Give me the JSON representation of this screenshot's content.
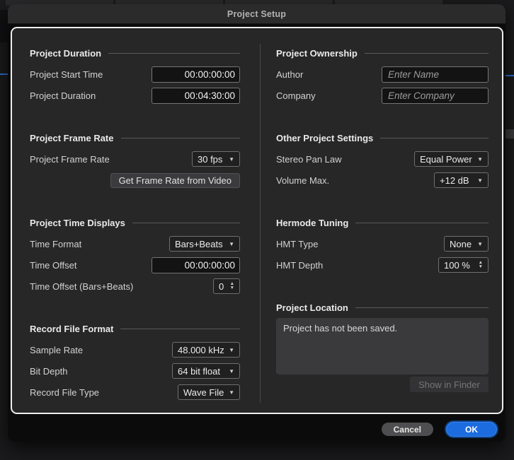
{
  "window": {
    "title": "Project Setup"
  },
  "icons": {
    "dropdown_arrow": "▼",
    "stepper_up": "▲",
    "stepper_down": "▼"
  },
  "colors": {
    "accent_blue": "#1c6cdf",
    "panel_bg": "#272728",
    "dialog_bg": "#0b0b0c",
    "panel_border": "#ededee"
  },
  "left": {
    "project_duration": {
      "title": "Project Duration",
      "start_time_label": "Project Start Time",
      "start_time_value": "00:00:00:00",
      "duration_label": "Project Duration",
      "duration_value": "00:04:30:00"
    },
    "project_frame_rate": {
      "title": "Project Frame Rate",
      "frame_rate_label": "Project Frame Rate",
      "frame_rate_value": "30 fps",
      "get_frame_rate_button": "Get Frame Rate from Video"
    },
    "project_time_displays": {
      "title": "Project Time Displays",
      "time_format_label": "Time Format",
      "time_format_value": "Bars+Beats",
      "time_offset_label": "Time Offset",
      "time_offset_value": "00:00:00:00",
      "time_offset_bb_label": "Time Offset (Bars+Beats)",
      "time_offset_bb_value": "0"
    },
    "record_file_format": {
      "title": "Record File Format",
      "sample_rate_label": "Sample Rate",
      "sample_rate_value": "48.000 kHz",
      "bit_depth_label": "Bit Depth",
      "bit_depth_value": "64 bit float",
      "record_file_type_label": "Record File Type",
      "record_file_type_value": "Wave File"
    }
  },
  "right": {
    "project_ownership": {
      "title": "Project Ownership",
      "author_label": "Author",
      "author_placeholder": "Enter Name",
      "company_label": "Company",
      "company_placeholder": "Enter Company"
    },
    "other_project_settings": {
      "title": "Other Project Settings",
      "stereo_pan_law_label": "Stereo Pan Law",
      "stereo_pan_law_value": "Equal Power",
      "volume_max_label": "Volume Max.",
      "volume_max_value": "+12 dB"
    },
    "hermode_tuning": {
      "title": "Hermode Tuning",
      "hmt_type_label": "HMT Type",
      "hmt_type_value": "None",
      "hmt_depth_label": "HMT Depth",
      "hmt_depth_value": "100 %"
    },
    "project_location": {
      "title": "Project Location",
      "status_text": "Project has not been saved.",
      "show_in_finder_button": "Show in Finder"
    }
  },
  "footer": {
    "cancel": "Cancel",
    "ok": "OK"
  }
}
